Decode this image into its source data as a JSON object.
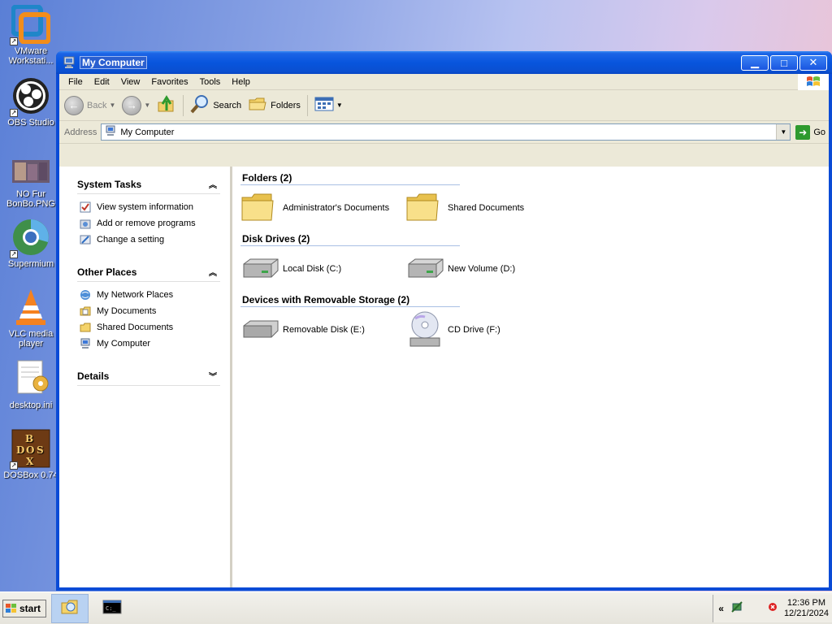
{
  "desktop": {
    "icons": [
      {
        "label": "VMware Workstati...",
        "icon": "vmware-icon"
      },
      {
        "label": "OBS Studio",
        "icon": "obs-icon"
      },
      {
        "label": "NO Fur BonBo.PNG",
        "icon": "image-file-icon"
      },
      {
        "label": "Supermium",
        "icon": "supermium-icon"
      },
      {
        "label": "VLC media player",
        "icon": "vlc-icon"
      },
      {
        "label": "desktop.ini",
        "icon": "settings-file-icon"
      },
      {
        "label": "DOSBox 0.74",
        "icon": "dosbox-icon"
      }
    ]
  },
  "window": {
    "title": "My Computer",
    "menu": [
      "File",
      "Edit",
      "View",
      "Favorites",
      "Tools",
      "Help"
    ],
    "toolbar": {
      "back": "Back",
      "search": "Search",
      "folders": "Folders"
    },
    "address": {
      "label": "Address",
      "value": "My Computer",
      "go": "Go"
    },
    "taskpane": {
      "system_tasks": {
        "title": "System Tasks",
        "links": [
          "View system information",
          "Add or remove programs",
          "Change a setting"
        ]
      },
      "other_places": {
        "title": "Other Places",
        "links": [
          "My Network Places",
          "My Documents",
          "Shared Documents",
          "My Computer"
        ]
      },
      "details": {
        "title": "Details"
      }
    },
    "groups": {
      "folders": {
        "title": "Folders (2)",
        "items": [
          "Administrator's Documents",
          "Shared Documents"
        ]
      },
      "disk_drives": {
        "title": "Disk Drives (2)",
        "items": [
          "Local Disk (C:)",
          "New Volume (D:)"
        ]
      },
      "removable": {
        "title": "Devices with Removable Storage (2)",
        "items": [
          "Removable Disk (E:)",
          "CD Drive (F:)"
        ]
      }
    }
  },
  "taskbar": {
    "start_label": "start",
    "tray_chevron": "«",
    "clock": {
      "time": "12:36 PM",
      "date": "12/21/2024"
    }
  },
  "colors": {
    "titlebar": "#0855dd",
    "folder_yellow": "#f6d56a",
    "group_rule": "#a9c0e4"
  }
}
